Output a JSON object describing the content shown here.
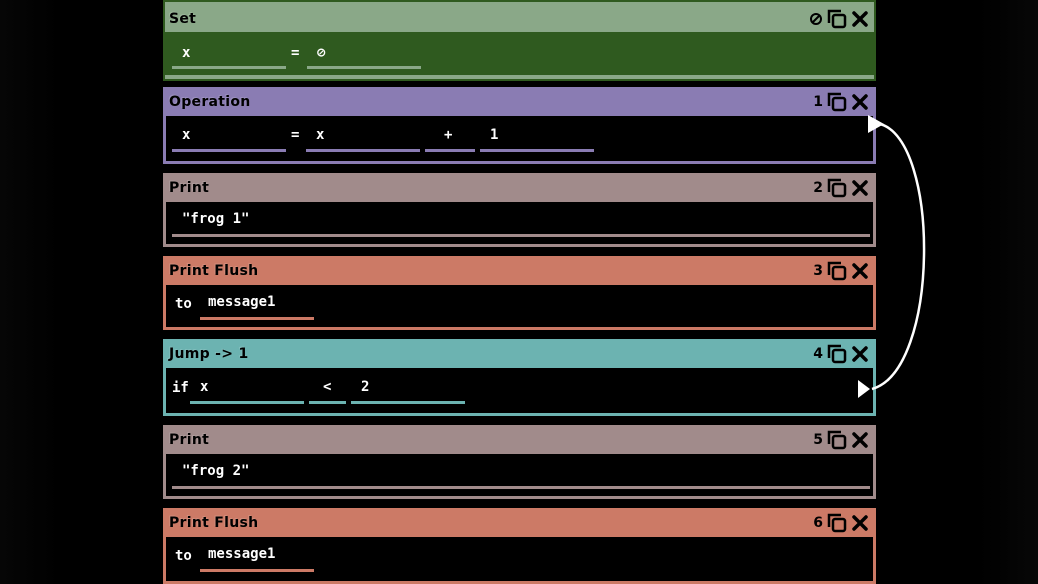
{
  "colors": {
    "set": "#8aa888",
    "set_body": "#2f5a1f",
    "operation": "#8a7cb3",
    "print": "#a18b8b",
    "print_flush": "#cc7a66",
    "jump": "#6cb3b1"
  },
  "blocks": [
    {
      "title": "Set",
      "index": "",
      "badge_icon": "null-icon",
      "fields": [
        {
          "value": "x"
        },
        {
          "value": "⊘"
        }
      ],
      "operators": [
        "="
      ]
    },
    {
      "title": "Operation",
      "index": "1",
      "fields": [
        {
          "value": "x"
        },
        {
          "value": "x"
        },
        {
          "value": "+"
        },
        {
          "value": "1"
        }
      ],
      "operators": [
        "="
      ]
    },
    {
      "title": "Print",
      "index": "2",
      "fields": [
        {
          "value": "\"frog 1\""
        }
      ]
    },
    {
      "title": "Print Flush",
      "index": "3",
      "keyword": "to",
      "fields": [
        {
          "value": "message1"
        }
      ]
    },
    {
      "title": "Jump -> 1",
      "index": "4",
      "keyword": "if",
      "fields": [
        {
          "value": "x"
        },
        {
          "value": "<"
        },
        {
          "value": "2"
        }
      ]
    },
    {
      "title": "Print",
      "index": "5",
      "fields": [
        {
          "value": "\"frog 2\""
        }
      ]
    },
    {
      "title": "Print Flush",
      "index": "6",
      "keyword": "to",
      "fields": [
        {
          "value": "message1"
        }
      ]
    }
  ],
  "icons": {
    "copy": "copy-icon",
    "delete": "close-icon"
  }
}
